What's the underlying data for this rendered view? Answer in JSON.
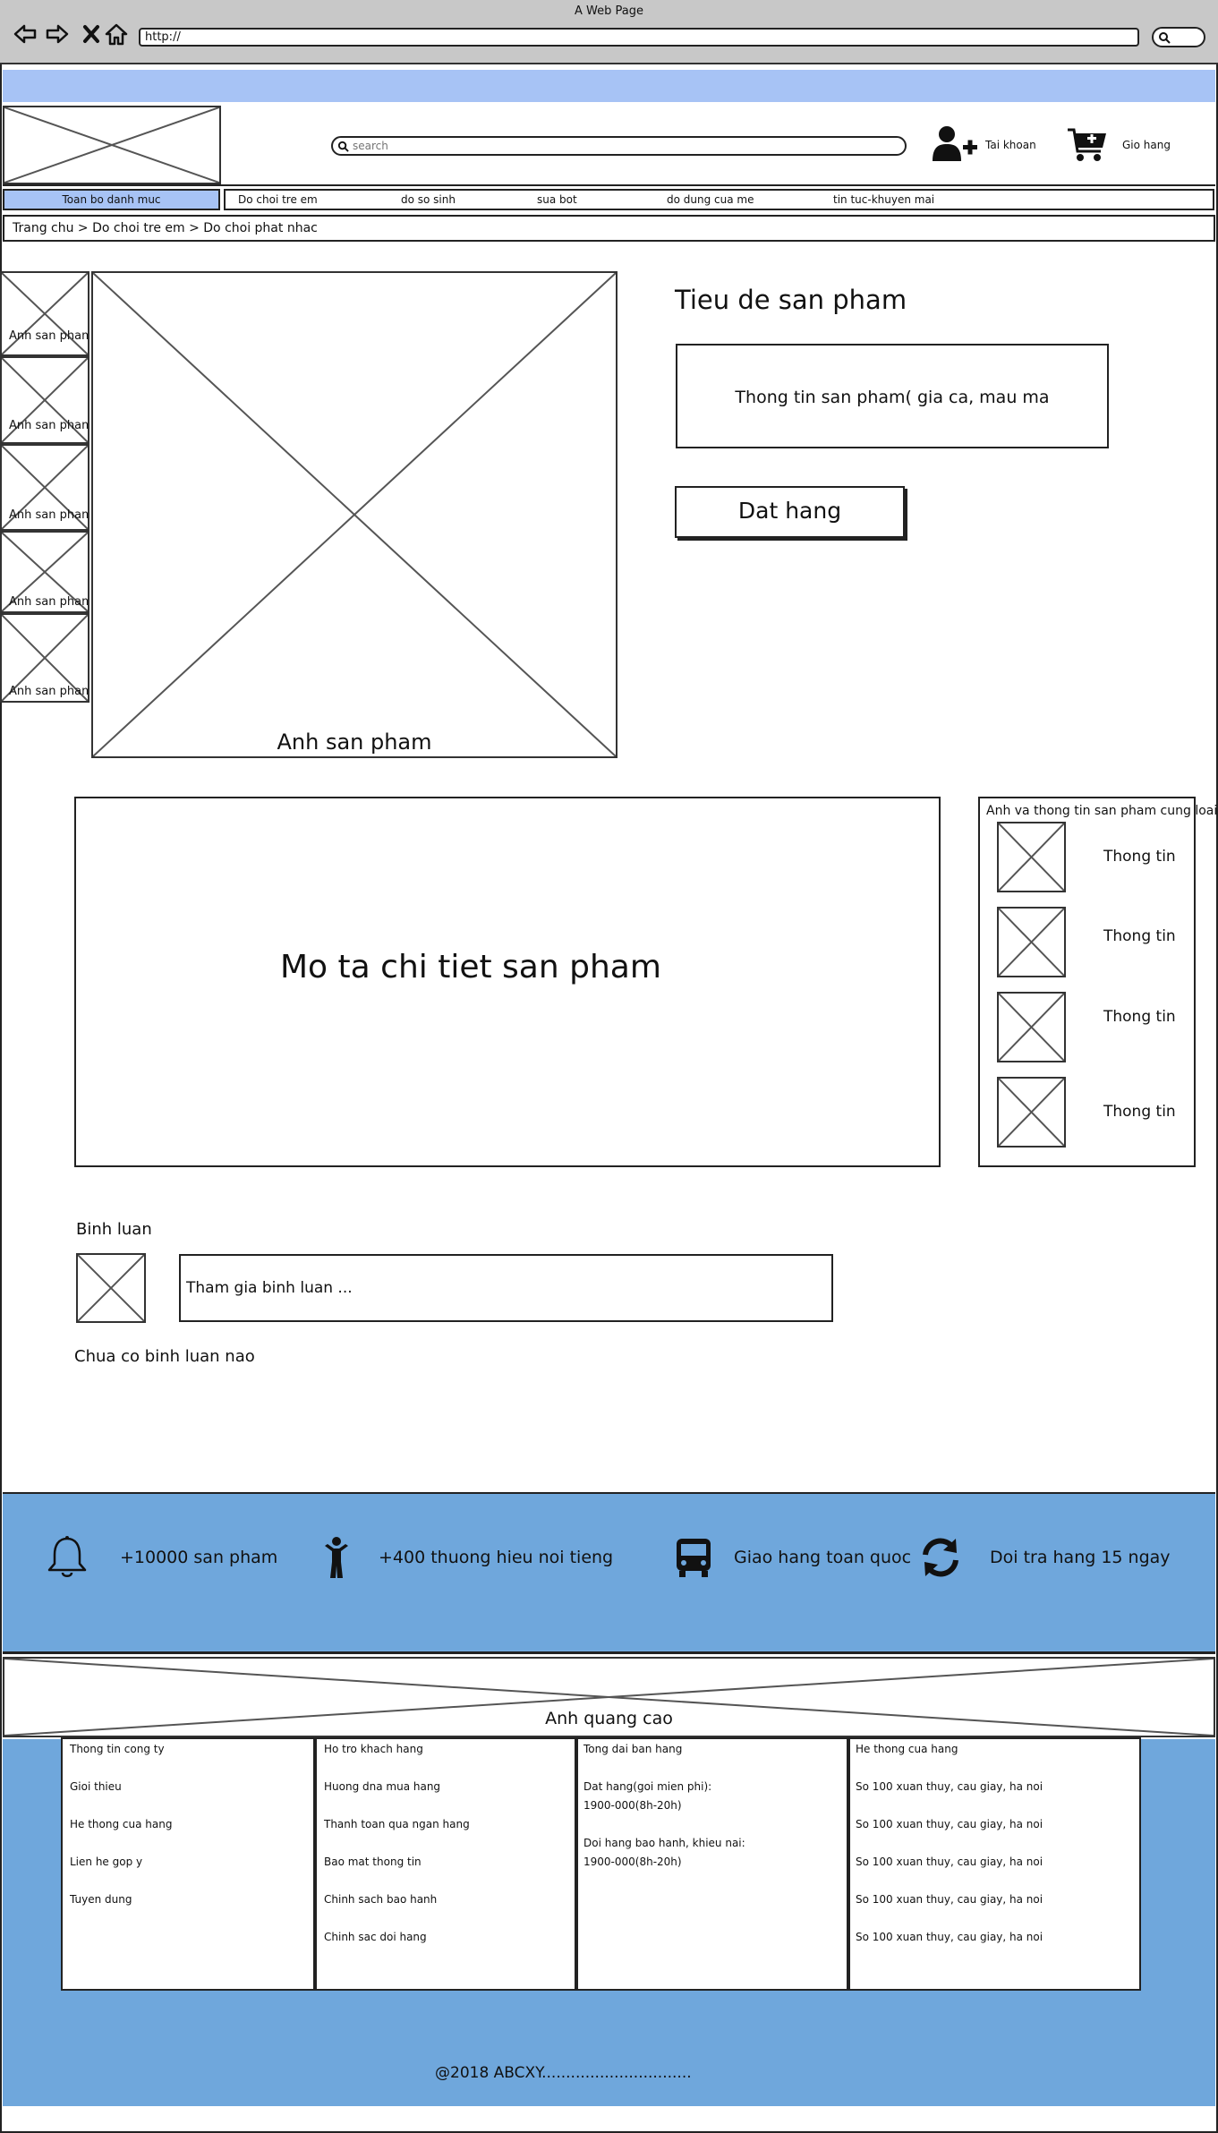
{
  "browser": {
    "title": "A Web Page",
    "url": "http://"
  },
  "header": {
    "search_placeholder": "search",
    "account_label": "Tai khoan",
    "cart_label": "Gio hang"
  },
  "nav": {
    "all_categories": "Toan bo danh muc",
    "items": [
      "Do choi tre em",
      "do so sinh",
      "sua bot",
      "do dung cua me",
      "tin tuc-khuyen mai"
    ]
  },
  "breadcrumb": "Trang chu  > Do choi tre em  > Do choi phat nhac",
  "product": {
    "thumb_label": "Anh san pham",
    "main_image_label": "Anh san pham",
    "title": "Tieu de san pham",
    "info": "Thong tin san pham( gia ca, mau ma",
    "order_button": "Dat hang"
  },
  "description": {
    "title": "Mo ta chi tiet san pham"
  },
  "related": {
    "title": "Anh va thong tin san pham cung loai",
    "item_label": "Thong tin"
  },
  "comments": {
    "heading": "Binh luan",
    "placeholder": "Tham gia binh luan ...",
    "empty": "Chua co binh luan nao"
  },
  "features": [
    {
      "icon": "bell-icon",
      "label": "+10000 san pham"
    },
    {
      "icon": "child-icon",
      "label": "+400 thuong hieu noi tieng"
    },
    {
      "icon": "bus-icon",
      "label": "Giao hang toan quoc"
    },
    {
      "icon": "refresh-icon",
      "label": "Doi tra hang 15 ngay"
    }
  ],
  "ad": {
    "label": "Anh quang cao"
  },
  "footer": {
    "company": {
      "title": "Thong tin cong ty",
      "items": [
        "Gioi thieu",
        "He thong cua hang",
        "Lien he gop y",
        "Tuyen dung"
      ]
    },
    "support": {
      "title": "Ho tro khach hang",
      "items": [
        "Huong dna mua hang",
        "Thanh toan qua ngan hang",
        "Bao mat thong tin",
        "Chinh sach bao hanh",
        "Chinh sac doi hang"
      ]
    },
    "hotline": {
      "title": "Tong dai ban hang",
      "order_label": "Dat hang(goi mien phi):",
      "order_number": "1900-000(8h-20h)",
      "warranty_label": "Doi hang bao hanh, khieu nai:",
      "warranty_number": "1900-000(8h-20h)"
    },
    "stores": {
      "title": "He thong cua hang",
      "items": [
        "So 100 xuan thuy, cau giay, ha noi",
        "So 100 xuan thuy, cau giay, ha noi",
        "So 100 xuan thuy, cau giay, ha noi",
        "So 100 xuan thuy, cau giay, ha noi",
        "So 100 xuan thuy, cau giay, ha noi"
      ]
    },
    "copyright": "@2018 ABCXY..............................."
  },
  "colors": {
    "nav_highlight": "#a7c3f5",
    "band_blue": "#6fa7dc",
    "chrome_gray": "#c8c8c8"
  }
}
